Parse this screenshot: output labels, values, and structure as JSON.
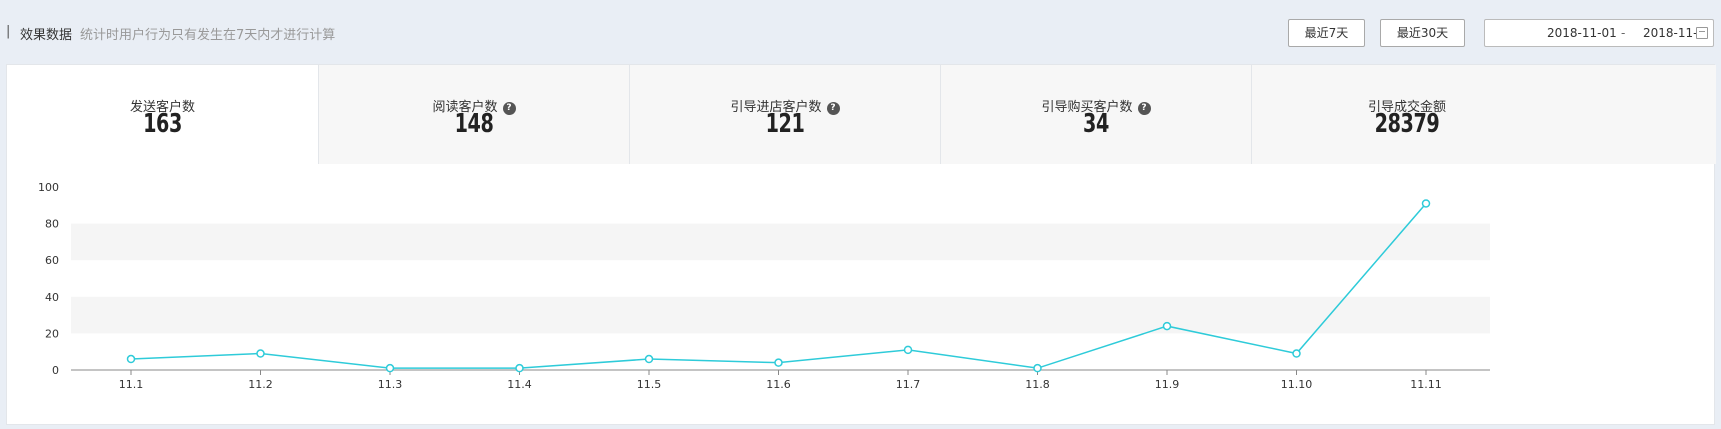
{
  "header": {
    "marker": "|",
    "title": "效果数据",
    "description": "统计时用户行为只有发生在7天内才进行计算",
    "btn_7days": "最近7天",
    "btn_30days": "最近30天",
    "date_start": "2018-11-01",
    "date_separator": "-",
    "date_end": "2018-11-",
    "calendar_icon": "calendar-icon"
  },
  "stats": [
    {
      "label": "发送客户数",
      "value": "163",
      "help": false
    },
    {
      "label": "阅读客户数",
      "value": "148",
      "help": true
    },
    {
      "label": "引导进店客户数",
      "value": "121",
      "help": true
    },
    {
      "label": "引导购买客户数",
      "value": "34",
      "help": true
    },
    {
      "label": "引导成交金额",
      "value": "28379",
      "help": false
    }
  ],
  "help_glyph": "?",
  "colors": {
    "line": "#2ecbd9",
    "band": "#f5f5f5",
    "axis": "#888888"
  },
  "chart_data": {
    "type": "line",
    "categories": [
      "11.1",
      "11.2",
      "11.3",
      "11.4",
      "11.5",
      "11.6",
      "11.7",
      "11.8",
      "11.9",
      "11.10",
      "11.11"
    ],
    "values": [
      6,
      9,
      1,
      1,
      6,
      4,
      11,
      1,
      24,
      9,
      91
    ],
    "ylim": [
      0,
      100
    ],
    "yticks": [
      "0",
      "20",
      "40",
      "60",
      "80",
      "100"
    ],
    "grid": "alternating bands",
    "legend": "none"
  }
}
